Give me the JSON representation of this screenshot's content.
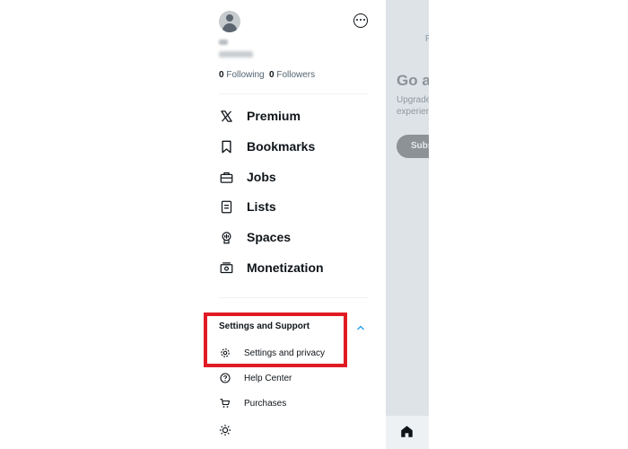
{
  "profile": {
    "following_count": "0",
    "following_label": "Following",
    "followers_count": "0",
    "followers_label": "Followers"
  },
  "menu": {
    "items": [
      {
        "label": "Premium",
        "icon": "x-logo-icon"
      },
      {
        "label": "Bookmarks",
        "icon": "bookmark-icon"
      },
      {
        "label": "Jobs",
        "icon": "briefcase-icon"
      },
      {
        "label": "Lists",
        "icon": "list-icon"
      },
      {
        "label": "Spaces",
        "icon": "microphone-icon"
      },
      {
        "label": "Monetization",
        "icon": "money-icon"
      }
    ]
  },
  "settings_support": {
    "title": "Settings and Support",
    "expanded": true,
    "items": [
      {
        "label": "Settings and privacy",
        "icon": "gear-icon"
      },
      {
        "label": "Help Center",
        "icon": "help-icon"
      },
      {
        "label": "Purchases",
        "icon": "cart-icon"
      }
    ],
    "theme_icon": "sun-icon"
  },
  "background": {
    "tab_text": "F",
    "heading": "Go a",
    "sub_line1": "Upgrade",
    "sub_line2": "experien",
    "button": "Subs"
  },
  "colors": {
    "highlight_border": "#e01b24",
    "chevron": "#1d9bf0",
    "text_primary": "#0f1419",
    "text_secondary": "#536471"
  }
}
